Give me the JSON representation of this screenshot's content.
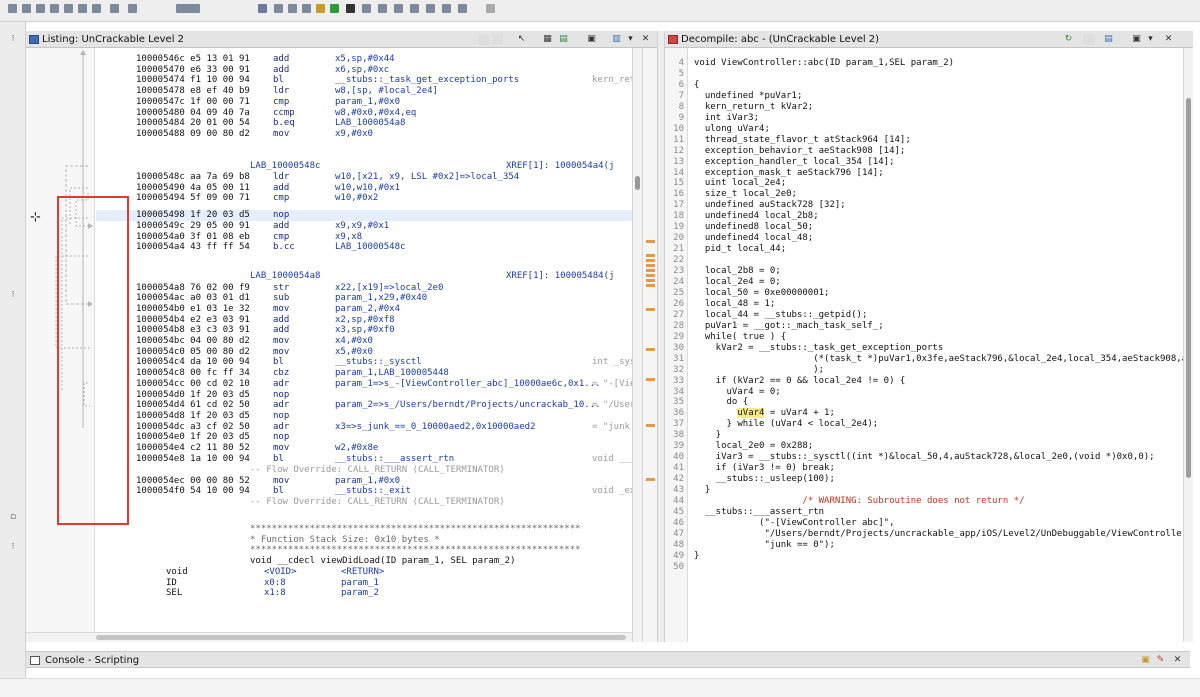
{
  "listing": {
    "title": "Listing: UnCrackable Level 2",
    "rows": [
      {
        "addr": "10000546c e5 13 01 91",
        "mn": "add",
        "op": "x5,sp,#0x44",
        "ann": ""
      },
      {
        "addr": "100005470 e6 33 00 91",
        "mn": "add",
        "op": "x6,sp,#0xc",
        "ann": ""
      },
      {
        "addr": "100005474 f1 10 00 94",
        "mn": "bl",
        "op": "__stubs::_task_get_exception_ports",
        "ann": "kern_ret"
      },
      {
        "addr": "100005478 e8 ef 40 b9",
        "mn": "ldr",
        "op": "w8,[sp, #local_2e4]",
        "ann": ""
      },
      {
        "addr": "10000547c 1f 00 00 71",
        "mn": "cmp",
        "op": "param_1,#0x0",
        "ann": ""
      },
      {
        "addr": "100005480 04 09 40 7a",
        "mn": "ccmp",
        "op": "w8,#0x0,#0x4,eq",
        "ann": ""
      },
      {
        "addr": "100005484 20 01 00 54",
        "mn": "b.eq",
        "op": "LAB_1000054a8",
        "ann": ""
      },
      {
        "addr": "100005488 09 00 80 d2",
        "mn": "mov",
        "op": "x9,#0x0",
        "ann": ""
      },
      {
        "addr": "10000548c aa 7a 69 b8",
        "mn": "ldr",
        "op": "w10,[x21, x9, LSL #0x2]=>local_354",
        "ann": ""
      },
      {
        "addr": "100005490 4a 05 00 11",
        "mn": "add",
        "op": "w10,w10,#0x1",
        "ann": ""
      },
      {
        "addr": "100005494 5f 09 00 71",
        "mn": "cmp",
        "op": "w10,#0x2",
        "ann": ""
      },
      {
        "addr": "100005498 1f 20 03 d5",
        "mn": "nop",
        "op": "",
        "ann": ""
      },
      {
        "addr": "10000549c 29 05 00 91",
        "mn": "add",
        "op": "x9,x9,#0x1",
        "ann": ""
      },
      {
        "addr": "1000054a0 3f 01 08 eb",
        "mn": "cmp",
        "op": "x9,x8",
        "ann": ""
      },
      {
        "addr": "1000054a4 43 ff ff 54",
        "mn": "b.cc",
        "op": "LAB_10000548c",
        "ann": ""
      },
      {
        "addr": "1000054a8 76 02 00 f9",
        "mn": "str",
        "op": "x22,[x19]=>local_2e0",
        "ann": ""
      },
      {
        "addr": "1000054ac a0 03 01 d1",
        "mn": "sub",
        "op": "param_1,x29,#0x40",
        "ann": ""
      },
      {
        "addr": "1000054b0 e1 03 1e 32",
        "mn": "mov",
        "op": "param_2,#0x4",
        "ann": ""
      },
      {
        "addr": "1000054b4 e2 e3 03 91",
        "mn": "add",
        "op": "x2,sp,#0xf8",
        "ann": ""
      },
      {
        "addr": "1000054b8 e3 c3 03 91",
        "mn": "add",
        "op": "x3,sp,#0xf0",
        "ann": ""
      },
      {
        "addr": "1000054bc 04 00 80 d2",
        "mn": "mov",
        "op": "x4,#0x0",
        "ann": ""
      },
      {
        "addr": "1000054c0 05 00 80 d2",
        "mn": "mov",
        "op": "x5,#0x0",
        "ann": ""
      },
      {
        "addr": "1000054c4 da 10 00 94",
        "mn": "bl",
        "op": "__stubs::_sysctl",
        "ann": "int _sys"
      },
      {
        "addr": "1000054c8 00 fc ff 34",
        "mn": "cbz",
        "op": "param_1,LAB_100005448",
        "ann": ""
      },
      {
        "addr": "1000054cc 00 cd 02 10",
        "mn": "adr",
        "op": "param_1=>s_-[ViewController_abc]_10000ae6c,0x1...",
        "ann": "= \"-[Vie"
      },
      {
        "addr": "1000054d0 1f 20 03 d5",
        "mn": "nop",
        "op": "",
        "ann": ""
      },
      {
        "addr": "1000054d4 61 cd 02 50",
        "mn": "adr",
        "op": "param_2=>s_/Users/berndt/Projects/uncrackab_10...",
        "ann": "= \"/User"
      },
      {
        "addr": "1000054d8 1f 20 03 d5",
        "mn": "nop",
        "op": "",
        "ann": ""
      },
      {
        "addr": "1000054dc a3 cf 02 50",
        "mn": "adr",
        "op": "x3=>s_junk_==_0_10000aed2,0x10000aed2",
        "ann": "= \"junk"
      },
      {
        "addr": "1000054e0 1f 20 03 d5",
        "mn": "nop",
        "op": "",
        "ann": ""
      },
      {
        "addr": "1000054e4 c2 11 80 52",
        "mn": "mov",
        "op": "w2,#0x8e",
        "ann": ""
      },
      {
        "addr": "1000054e8 1a 10 00 94",
        "mn": "bl",
        "op": "__stubs::___assert_rtn",
        "ann": "void ___"
      },
      {
        "addr": "1000054ec 00 00 80 52",
        "mn": "mov",
        "op": "param_1,#0x0",
        "ann": ""
      },
      {
        "addr": "1000054f0 54 10 00 94",
        "mn": "bl",
        "op": "__stubs::_exit",
        "ann": "void _ex"
      }
    ],
    "label_1": "LAB_10000548c",
    "xref_1": "XREF[1]:     1000054a4(j",
    "label_2": "LAB_1000054a8",
    "xref_2": "XREF[1]:     100005484(j",
    "override_1": "-- Flow Override: CALL_RETURN (CALL_TERMINATOR)",
    "override_2": "-- Flow Override: CALL_RETURN (CALL_TERMINATOR)",
    "stars": "*************************************************************",
    "stack_size": "* Function Stack Size: 0x10 bytes                            *",
    "func_sig": "void __cdecl viewDidLoad(ID param_1, SEL param_2)",
    "params": [
      {
        "type": "void",
        "storage": "<VOID>",
        "name": "<RETURN>"
      },
      {
        "type": "ID",
        "storage": "x0:8",
        "name": "param_1"
      },
      {
        "type": "SEL",
        "storage": "x1:8",
        "name": "param_2"
      }
    ]
  },
  "decompile": {
    "title": "Decompile: abc -  (UnCrackable Level 2)",
    "line_numbers": [
      "4",
      "5",
      "6",
      "7",
      "8",
      "9",
      "10",
      "11",
      "12",
      "13",
      "14",
      "15",
      "16",
      "17",
      "18",
      "19",
      "20",
      "21",
      "22",
      "23",
      "24",
      "25",
      "26",
      "27",
      "28",
      "29",
      "30",
      "31",
      "32",
      "33",
      "34",
      "35",
      "36",
      "37",
      "38",
      "39",
      "40",
      "41",
      "42",
      "43",
      "44",
      "45",
      "46",
      "47",
      "48",
      "49",
      "50"
    ],
    "lines": [
      "void ViewController::abc(ID param_1,SEL param_2)",
      "",
      "{",
      "  undefined *puVar1;",
      "  kern_return_t kVar2;",
      "  int iVar3;",
      "  ulong uVar4;",
      "  thread_state_flavor_t atStack964 [14];",
      "  exception_behavior_t aeStack908 [14];",
      "  exception_handler_t local_354 [14];",
      "  exception_mask_t aeStack796 [14];",
      "  uint local_2e4;",
      "  size_t local_2e0;",
      "  undefined auStack728 [32];",
      "  undefined4 local_2b8;",
      "  undefined8 local_50;",
      "  undefined4 local_48;",
      "  pid_t local_44;",
      "",
      "  local_2b8 = 0;",
      "  local_2e4 = 0;",
      "  local_50 = 0xe00000001;",
      "  local_48 = 1;",
      "  local_44 = __stubs::_getpid();",
      "  puVar1 = __got::_mach_task_self_;",
      "  while( true ) {",
      "    kVar2 = __stubs::_task_get_exception_ports",
      "                      (*(task_t *)puVar1,0x3fe,aeStack796,&local_2e4,local_354,aeStack908,atSta",
      "                      );",
      "    if (kVar2 == 0 && local_2e4 != 0) {",
      "      uVar4 = 0;",
      "      do {",
      "        uVar4 = uVar4 + 1;",
      "      } while (uVar4 < local_2e4);",
      "    }",
      "    local_2e0 = 0x288;",
      "    iVar3 = __stubs::_sysctl((int *)&local_50,4,auStack728,&local_2e0,(void *)0x0,0);",
      "    if (iVar3 != 0) break;",
      "    __stubs::_usleep(100);",
      "  }",
      "                    /* WARNING: Subroutine does not return */",
      "  __stubs::___assert_rtn",
      "            (\"-[ViewController abc]\",",
      "             \"/Users/berndt/Projects/uncrackable_app/iOS/Level2/UnDebuggable/ViewController.m",
      "             \"junk == 0\");",
      "}",
      ""
    ]
  },
  "console": {
    "title": "Console - Scripting"
  },
  "colors": {
    "accent": "#3d6cb2",
    "annotation_box": "#e23b2e",
    "highlight_var": "#f8e88a",
    "selected_row": "#e6eefb"
  }
}
